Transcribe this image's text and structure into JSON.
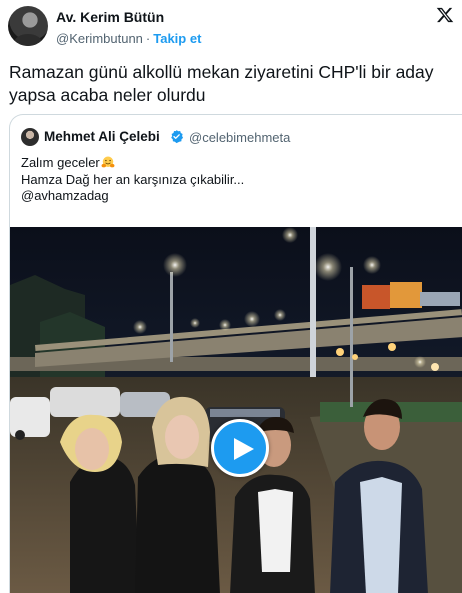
{
  "author": {
    "name": "Av. Kerim Bütün",
    "handle": "@Kerimbutunn",
    "separator": "·",
    "follow_label": "Takip et"
  },
  "tweet": {
    "text": "Ramazan günü alkollü mekan ziyaretini CHP'li bir aday yapsa acaba neler olurdu"
  },
  "quoted": {
    "name": "Mehmet Ali Çelebi",
    "handle": "@celebimehmeta",
    "lines": [
      "Zalım geceler",
      "Hamza Dağ her an karşınıza çıkabilir...",
      "@avhamzadag"
    ],
    "emoji": "hugging-face-icon"
  },
  "media": {
    "type": "video",
    "play_icon": "play-icon"
  },
  "colors": {
    "accent": "#1d9bf0",
    "text": "#0f1419",
    "muted": "#536471",
    "border": "#cfd9de"
  },
  "icons": {
    "brand": "x-logo-icon",
    "verified": "verified-badge-icon"
  }
}
